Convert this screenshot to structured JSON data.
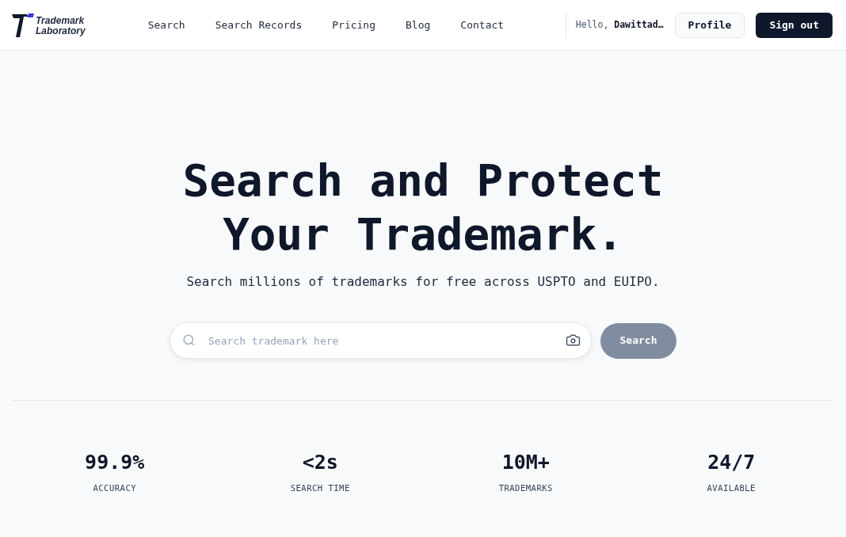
{
  "header": {
    "logo": {
      "line_1": "Trademark",
      "line_2": "Laboratory"
    },
    "nav": [
      {
        "label": "Search"
      },
      {
        "label": "Search Records"
      },
      {
        "label": "Pricing"
      },
      {
        "label": "Blog"
      },
      {
        "label": "Contact"
      }
    ],
    "greeting": "Hello, **Dawittad…**",
    "buttons": [
      {
        "label": "Profile",
        "kind": "secondary"
      },
      {
        "label": "Sign out",
        "kind": "primary"
      }
    ]
  },
  "hero": {
    "title": "Search and Protect Your Trademark.",
    "subtitle": "Search millions of trademarks for free across USPTO and EUIPO.",
    "search": {
      "placeholder": "Search trademark here",
      "button": {
        "label": "Search",
        "disabled": true
      }
    }
  },
  "stats": [
    {
      "value": "99.9%",
      "label": "ACCURACY"
    },
    {
      "value": "<2s",
      "label": "SEARCH TIME"
    },
    {
      "value": "10M+",
      "label": "TRADEMARKS"
    },
    {
      "value": "24/7",
      "label": "AVAILABLE"
    }
  ]
}
